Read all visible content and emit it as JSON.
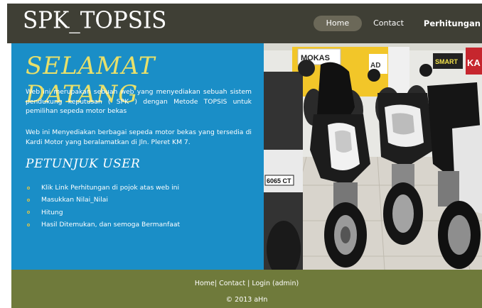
{
  "header": {
    "logo": "SPK_TOPSIS",
    "nav": [
      "Home",
      "Contact",
      "Perhitungan"
    ]
  },
  "main": {
    "welcome_title": "SELAMAT DATANG",
    "paragraph1": "Web ini merupakan sebuah web yang menyediakan sebuah sistem pendukung keputusan ( SPK ) dengan Metode TOPSIS untuk pemilihan sepeda motor bekas",
    "paragraph2": "Web ini Menyediakan berbagai sepeda motor bekas yang tersedia di Kardi Motor yang beralamatkan di Jln. Pleret KM 7.",
    "petunjuk_title": "PETUNJUK USER",
    "steps": [
      "Klik Link Perhitungan di pojok atas web ini",
      "Masukkan Nilai_Nilai",
      "Hitung",
      "Hasil Ditemukan, dan semoga Bermanfaat"
    ],
    "photo_signs": [
      "MOKAS",
      "SMART",
      "KA",
      "AD"
    ],
    "plate_text": "6065 CT"
  },
  "footer": {
    "home": "Home",
    "sep1": "|",
    "contact": "Contact",
    "sep2": "|",
    "login": "Login (admin)",
    "copyright": "© 2013 aHn"
  },
  "colors": {
    "header_bg": "#3f3f35",
    "content_bg": "#1a8ec7",
    "footer_bg": "#6f7a3b",
    "title_yellow": "#e8e06a"
  }
}
